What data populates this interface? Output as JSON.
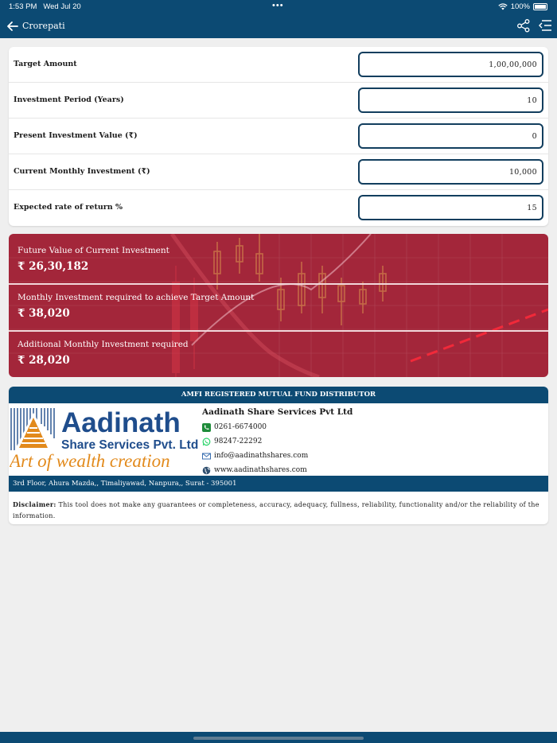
{
  "status_bar": {
    "time": "1:53 PM",
    "date": "Wed Jul 20",
    "battery": "100%"
  },
  "nav": {
    "title": "Crorepati",
    "back_icon": "arrow-left-icon",
    "share_icon": "share-icon",
    "menu_icon": "menu-list-icon"
  },
  "form": {
    "fields": [
      {
        "label": "Target Amount",
        "value": "1,00,00,000"
      },
      {
        "label": "Investment Period (Years)",
        "value": "10"
      },
      {
        "label": "Present Investment Value (₹)",
        "value": "0"
      },
      {
        "label": "Current Monthly Investment (₹)",
        "value": "10,000"
      },
      {
        "label": "Expected rate of return %",
        "value": "15"
      }
    ]
  },
  "results": [
    {
      "label": "Future Value of Current Investment",
      "value": "₹ 26,30,182"
    },
    {
      "label": "Monthly Investment required to achieve Target Amount",
      "value": "₹ 38,020"
    },
    {
      "label": "Additional Monthly Investment required",
      "value": "₹ 28,020"
    }
  ],
  "distributor": {
    "header": "AMFI REGISTERED MUTUAL FUND DISTRIBUTOR",
    "logo": {
      "line1": "Aadinath",
      "line2": "Share Services Pvt. Ltd.",
      "tagline": "Art of wealth creation"
    },
    "company": "Aadinath Share Services Pvt Ltd",
    "phone": "0261-6674000",
    "whatsapp": "98247-22292",
    "email": "info@aadinathshares.com",
    "website": "www.aadinathshares.com",
    "address": "3rd Floor, Ahura Mazda,, Timaliyawad, Nanpura,, Surat - 395001"
  },
  "disclaimer": {
    "label": "Disclaimer:",
    "text": "This tool does not make any guarantees or completeness, accuracy, adequacy, fullness, reliability, functionality and/or the reliability of the information."
  },
  "colors": {
    "brand_blue": "#0c4a73",
    "result_red": "#a3263a",
    "whatsapp_green": "#25d366"
  }
}
